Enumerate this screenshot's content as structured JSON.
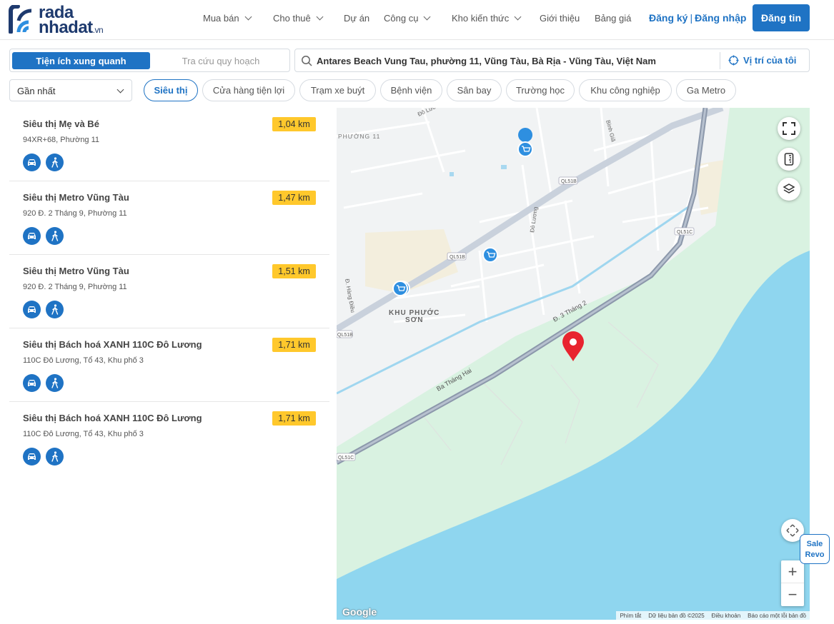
{
  "brand": {
    "line1": "rada",
    "line2": "nhadat",
    "tld": ".vn",
    "color": "#1e3a6e"
  },
  "nav": [
    {
      "label": "Mua bán",
      "dropdown": true
    },
    {
      "label": "Cho thuê",
      "dropdown": true
    },
    {
      "label": "Dự án",
      "dropdown": false
    },
    {
      "label": "Công cụ",
      "dropdown": true
    },
    {
      "label": "Kho kiến thức",
      "dropdown": true
    },
    {
      "label": "Giới thiệu",
      "dropdown": false
    },
    {
      "label": "Bảng giá",
      "dropdown": false
    }
  ],
  "auth": {
    "register": "Đăng ký",
    "separator": "|",
    "login": "Đăng nhập"
  },
  "post_button": "Đăng tin",
  "accent_color": "#1f73c4",
  "toggle": {
    "active": "Tiện ích xung quanh",
    "inactive": "Tra cứu quy hoạch"
  },
  "search": {
    "value": "Antares Beach Vung Tau, phường 11, Vũng Tàu, Bà Rịa - Vũng Tàu, Việt Nam",
    "my_location": "Vị trí của tôi"
  },
  "sort": {
    "selected": "Gần nhất"
  },
  "categories": [
    "Siêu thị",
    "Cửa hàng tiện lợi",
    "Trạm xe buýt",
    "Bệnh viện",
    "Sân bay",
    "Trường học",
    "Khu công nghiệp",
    "Ga Metro"
  ],
  "active_category": "Siêu thị",
  "results": [
    {
      "name": "Siêu thị Mẹ và Bé",
      "address": "94XR+68, Phường 11",
      "distance": "1,04 km"
    },
    {
      "name": "Siêu thị Metro Vũng Tàu",
      "address": "920 Đ. 2 Tháng 9, Phường 11",
      "distance": "1,47 km"
    },
    {
      "name": "Siêu thị Metro Vũng Tàu",
      "address": "920 Đ. 2 Tháng 9, Phường 11",
      "distance": "1,51 km"
    },
    {
      "name": "Siêu thị Bách hoá XANH 110C Đô Lương",
      "address": "110C Đô Lương, Tổ 43, Khu phố 3",
      "distance": "1,71 km"
    },
    {
      "name": "Siêu thị Bách hoá XANH 110C Đô Lương",
      "address": "110C Đô Lương, Tổ 43, Khu phố 3",
      "distance": "1,71 km"
    }
  ],
  "distance_badge_color": "#ffc82c",
  "map": {
    "labels": {
      "phuong": "PHƯỜNG 11",
      "khu1": "KHU PHƯỚC",
      "khu2": "SƠN",
      "road_3thang2": "Đ. 3 Tháng 2",
      "road_bathanghai": "Ba Tháng Hai",
      "road_doluong": "Đô Lương",
      "road_doluong_top": "Đô Lương",
      "road_binhgia": "Bình Giã",
      "road_hungdieu": "Đ. Hàng Điều",
      "ql51b_1": "QL51B",
      "ql51b_2": "QL51B",
      "ql51b_3": "QL51B",
      "ql51c_1": "QL51C",
      "ql51c_2": "QL51C"
    },
    "google": "Google",
    "attribution": [
      "Phím tắt",
      "Dữ liệu bản đồ ©2025",
      "Điều khoản",
      "Báo cáo một lỗi bản đồ"
    ],
    "zoom_in": "+",
    "zoom_out": "−",
    "sea_color": "#8fd6ef",
    "green_color": "#d9f2e1"
  },
  "sale_widget": {
    "line1": "Sale",
    "line2": "Revo"
  }
}
